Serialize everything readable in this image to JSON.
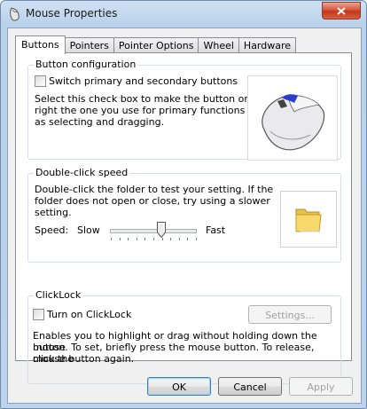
{
  "window": {
    "title": "Mouse Properties"
  },
  "tabs": [
    "Buttons",
    "Pointers",
    "Pointer Options",
    "Wheel",
    "Hardware"
  ],
  "button_config": {
    "group_label": "Button configuration",
    "checkbox_label": "Switch primary and secondary buttons",
    "checked": false,
    "description_lines": [
      "Select this check box to make the button on the",
      "right the one you use for primary functions such",
      "as selecting and dragging."
    ]
  },
  "double_click": {
    "group_label": "Double-click speed",
    "description_lines": [
      "Double-click the folder to test your setting. If the",
      "folder does not open or close, try using a slower",
      "setting."
    ],
    "speed_label": "Speed:",
    "slow_label": "Slow",
    "fast_label": "Fast",
    "slider_value": 0.6,
    "tick_count": 11
  },
  "clicklock": {
    "group_label": "ClickLock",
    "checkbox_label": "Turn on ClickLock",
    "checked": false,
    "settings_label": "Settings...",
    "description_lines": [
      "Enables you to highlight or drag without holding down the mouse",
      "button. To set, briefly press the mouse button. To release, click the",
      "mouse button again."
    ]
  },
  "footer": {
    "ok": "OK",
    "cancel": "Cancel",
    "apply": "Apply"
  },
  "colors": {
    "accent": "#3c7fb1",
    "titlebar": "#b9d1ea",
    "close": "#c5371c"
  }
}
